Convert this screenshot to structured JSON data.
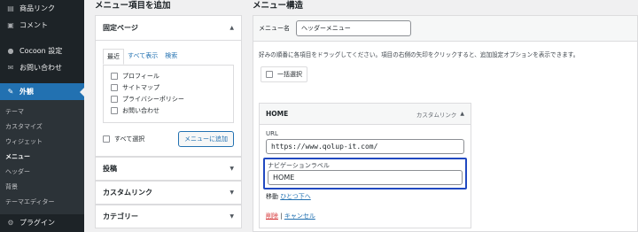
{
  "sidebar": {
    "items_top": [
      {
        "icon": "▤",
        "label": "商品リンク"
      },
      {
        "icon": "▣",
        "label": "コメント"
      }
    ],
    "items_mid": [
      {
        "icon": "●",
        "label": "Cocoon 設定"
      },
      {
        "icon": "✉",
        "label": "お問い合わせ"
      }
    ],
    "active": {
      "icon": "✎",
      "label": "外観"
    },
    "submenu": [
      "テーマ",
      "カスタマイズ",
      "ウィジェット",
      "メニュー",
      "ヘッダー",
      "背景",
      "テーマエディター"
    ],
    "current_submenu": "メニュー",
    "plugins": {
      "icon": "⚙",
      "label": "プラグイン"
    }
  },
  "add_panel": {
    "title": "メニュー項目を追加",
    "fixed_pages": {
      "label": "固定ページ",
      "tabs": [
        "最近",
        "すべて表示",
        "検索"
      ],
      "pages": [
        "プロフィール",
        "サイトマップ",
        "プライバシーポリシー",
        "お問い合わせ"
      ],
      "select_all": "すべて選択",
      "add_button": "メニューに追加"
    },
    "sections": [
      "投稿",
      "カスタムリンク",
      "カテゴリー"
    ]
  },
  "structure": {
    "title": "メニュー構造",
    "menu_name_label": "メニュー名",
    "menu_name_value": "ヘッダーメニュー",
    "help_text": "好みの順番に各項目をドラッグしてください。項目の右側の矢印をクリックすると、追加設定オプションを表示できます。",
    "bulk_select": "一括選択",
    "item": {
      "title": "HOME",
      "type": "カスタムリンク",
      "url_label": "URL",
      "url_value": "https://www.qolup-it.com/",
      "nav_label": "ナビゲーションラベル",
      "nav_value": "HOME",
      "move_label": "移動",
      "move_link": "ひとつ下へ",
      "delete": "削除",
      "separator": "|",
      "cancel": "キャンセル"
    }
  },
  "colors": {
    "sidebar_bg": "#1d2327",
    "accent": "#2271b1",
    "highlight_border": "#2149c1",
    "delete": "#d63638"
  }
}
